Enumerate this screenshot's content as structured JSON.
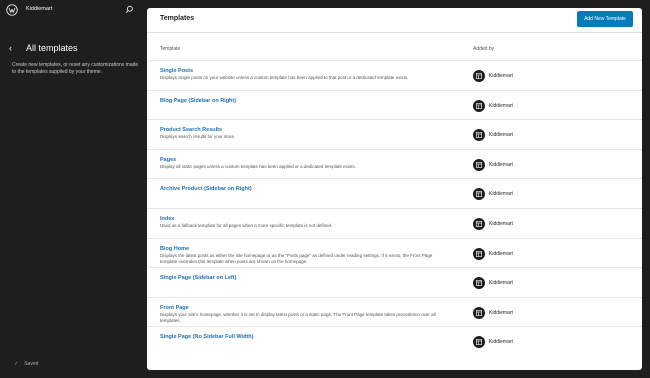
{
  "sidebar": {
    "site_name": "Kiddiemart",
    "title": "All templates",
    "description": "Create new templates, or reset any customizations made to the templates supplied by your theme.",
    "status": "Saved"
  },
  "main": {
    "title": "Templates",
    "add_button": "Add New Template",
    "columns": {
      "template": "Template",
      "added_by": "Added by"
    },
    "rows": [
      {
        "name": "Single Posts",
        "description": "Displays single posts on your website unless a custom template has been applied to that post or a dedicated template exists.",
        "added_by": "Kiddiemart"
      },
      {
        "name": "Blog Page (Sidebar on Right)",
        "description": "",
        "added_by": "Kiddiemart"
      },
      {
        "name": "Product Search Results",
        "description": "Displays search results for your store.",
        "added_by": "Kiddiemart"
      },
      {
        "name": "Pages",
        "description": "Display all static pages unless a custom template has been applied or a dedicated template exists.",
        "added_by": "Kiddiemart"
      },
      {
        "name": "Archive Product (Sidebar on Right)",
        "description": "",
        "added_by": "Kiddiemart"
      },
      {
        "name": "Index",
        "description": "Used as a fallback template for all pages when a more specific template is not defined.",
        "added_by": "Kiddiemart"
      },
      {
        "name": "Blog Home",
        "description": "Displays the latest posts as either the site homepage or as the \"Posts page\" as defined under reading settings. If it exists, the Front Page template overrides this template when posts are shown on the homepage.",
        "added_by": "Kiddiemart"
      },
      {
        "name": "Single Page (Sidebar on Left)",
        "description": "",
        "added_by": "Kiddiemart"
      },
      {
        "name": "Front Page",
        "description": "Displays your site's homepage, whether it is set to display latest posts or a static page. The Front Page template takes precedence over all templates.",
        "added_by": "Kiddiemart"
      },
      {
        "name": "Single Page (No Sidebar Full Width)",
        "description": "",
        "added_by": "Kiddiemart"
      }
    ]
  }
}
